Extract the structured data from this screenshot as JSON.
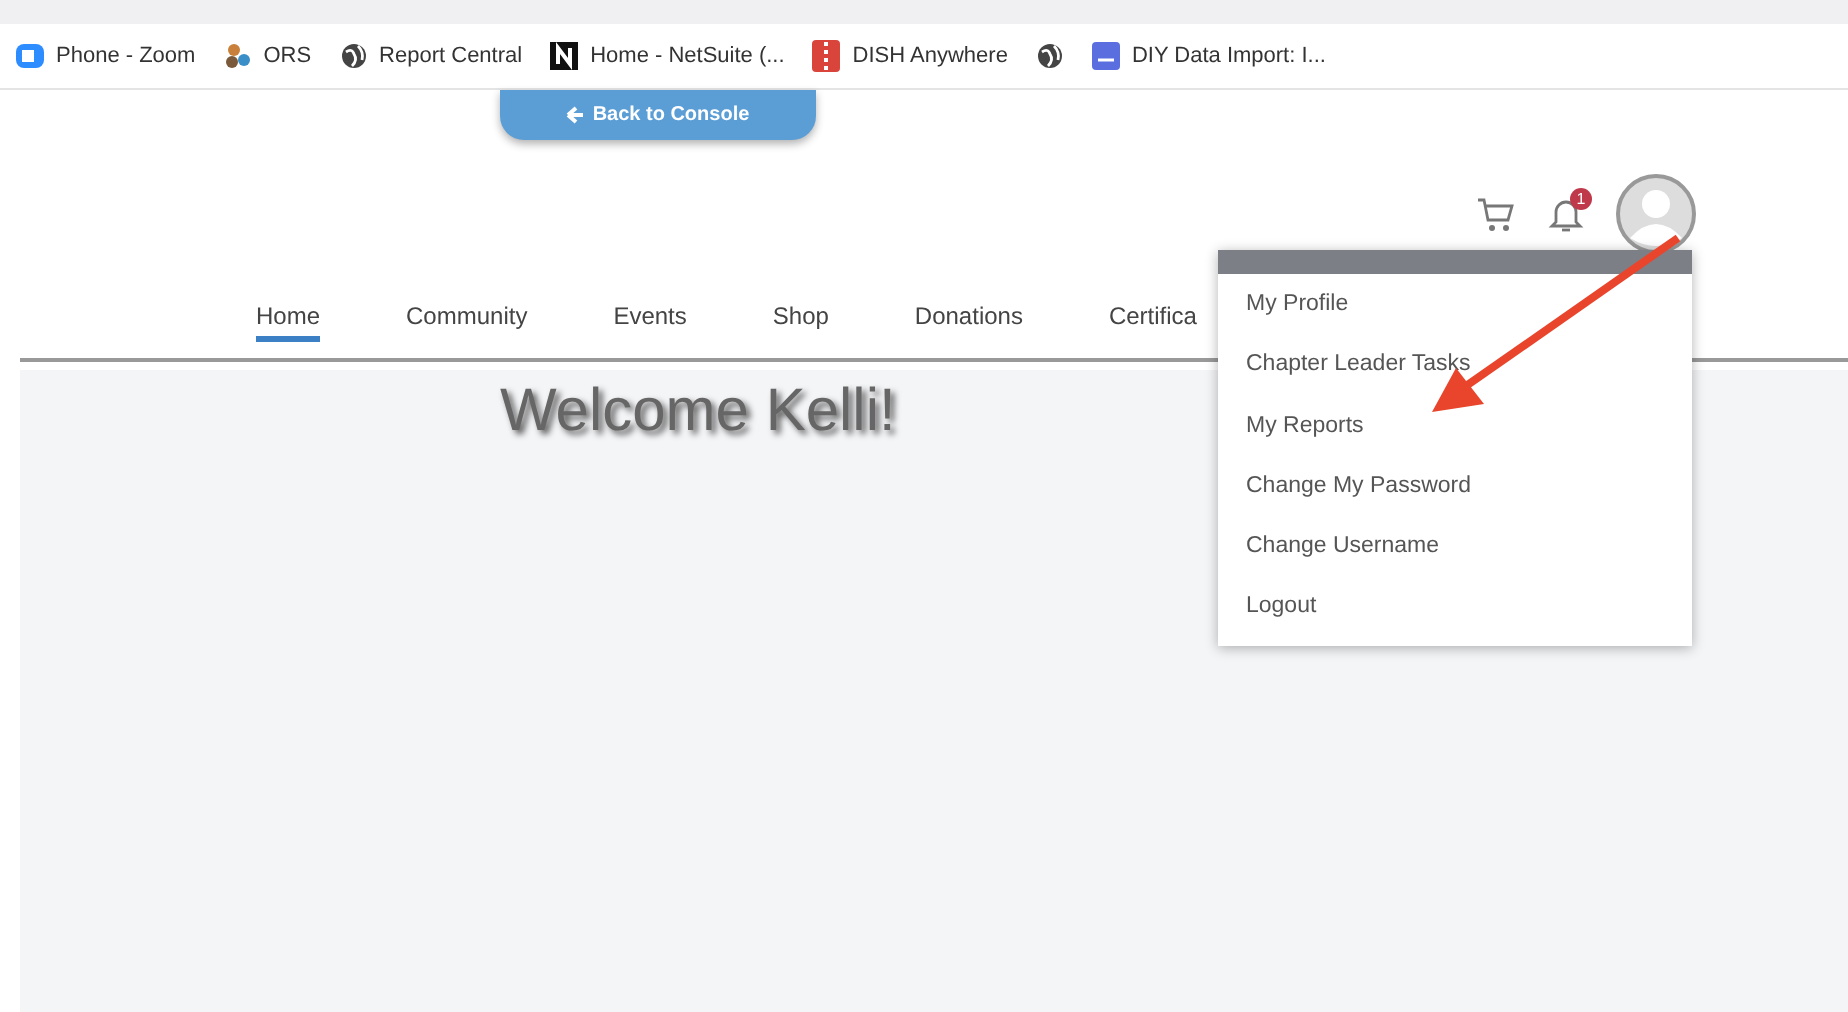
{
  "bookmarks": [
    {
      "label": "Phone - Zoom",
      "kind": "zoom"
    },
    {
      "label": "ORS",
      "kind": "people"
    },
    {
      "label": "Report Central",
      "kind": "globe"
    },
    {
      "label": "Home - NetSuite (...",
      "kind": "netsuite"
    },
    {
      "label": "DISH Anywhere",
      "kind": "dish"
    },
    {
      "kind": "globe"
    },
    {
      "label": "DIY Data Import: I...",
      "kind": "hs"
    }
  ],
  "back_button": "Back to Console",
  "notifications": {
    "count": "1"
  },
  "nav": [
    {
      "label": "Home",
      "selected": true
    },
    {
      "label": "Community",
      "selected": false
    },
    {
      "label": "Events",
      "selected": false
    },
    {
      "label": "Shop",
      "selected": false
    },
    {
      "label": "Donations",
      "selected": false
    },
    {
      "label": "Certifica",
      "selected": false
    }
  ],
  "welcome": "Welcome Kelli!",
  "menu": [
    "My Profile",
    "Chapter Leader Tasks",
    "My Reports",
    "Change My Password",
    "Change Username",
    "Logout"
  ]
}
